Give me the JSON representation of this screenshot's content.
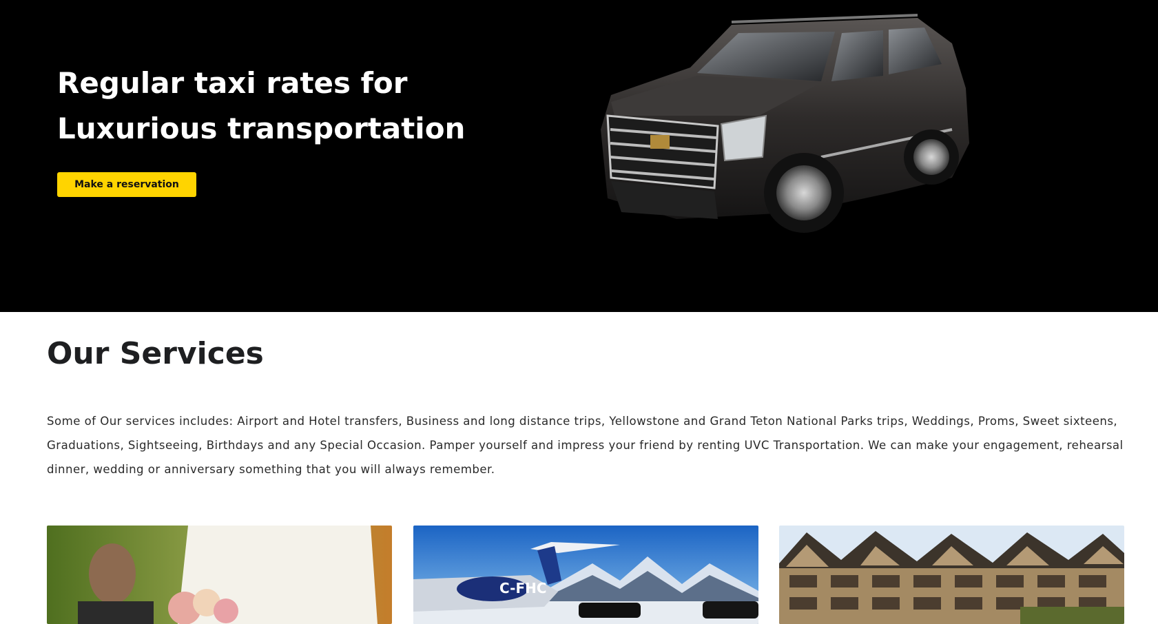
{
  "hero": {
    "title_line1": "Regular taxi rates for",
    "title_line2": "Luxurious transportation",
    "cta_label": "Make a reservation",
    "background_color": "#000000",
    "accent_color": "#ffd400",
    "image_icon": "suv-car-image"
  },
  "services": {
    "title": "Our Services",
    "description": "Some of Our services includes: Airport and Hotel transfers, Business and long distance trips, Yellowstone and Grand Teton National Parks trips, Weddings, Proms, Sweet sixteens, Graduations, Sightseeing, Birthdays and any Special Occasion. Pamper yourself and impress your friend by renting UVC Transportation. We can make your engagement, rehearsal dinner, wedding or anniversary something that you will always remember.",
    "cards": [
      {
        "image": "wedding-couple-image"
      },
      {
        "image": "private-jet-image",
        "jet_tail_text": "C-FHC"
      },
      {
        "image": "lodge-hotel-image"
      }
    ]
  }
}
